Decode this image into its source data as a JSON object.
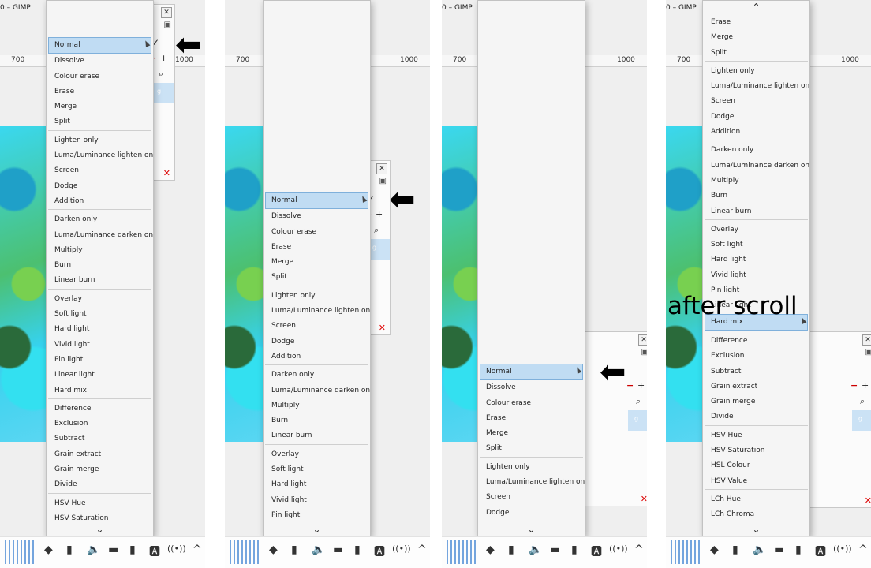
{
  "titles": [
    "0 – GIMP",
    "0 – GIMP",
    "0 – GIMP"
  ],
  "ruler": {
    "left": "700",
    "right": "1000"
  },
  "dock": {
    "close": "✕",
    "mode": "✓",
    "minus": "−",
    "plus": "+",
    "search": "⌕",
    "delete": "✕",
    "brush": "▣"
  },
  "arrow": "⬅",
  "overlay_text": "after scroll",
  "menu_full": [
    "Normal",
    "Dissolve",
    "Colour erase",
    "Erase",
    "Merge",
    "Split",
    "-",
    "Lighten only",
    "Luma/Luminance lighten only",
    "Screen",
    "Dodge",
    "Addition",
    "-",
    "Darken only",
    "Luma/Luminance darken only",
    "Multiply",
    "Burn",
    "Linear burn",
    "-",
    "Overlay",
    "Soft light",
    "Hard light",
    "Vivid light",
    "Pin light",
    "Linear light",
    "Hard mix",
    "-",
    "Difference",
    "Exclusion",
    "Subtract",
    "Grain extract",
    "Grain merge",
    "Divide",
    "-",
    "HSV Hue",
    "HSV Saturation"
  ],
  "menu_mid": [
    "Normal",
    "Dissolve",
    "Colour erase",
    "Erase",
    "Merge",
    "Split",
    "-",
    "Lighten only",
    "Luma/Luminance lighten only",
    "Screen",
    "Dodge",
    "Addition",
    "-",
    "Darken only",
    "Luma/Luminance darken only",
    "Multiply",
    "Burn",
    "Linear burn",
    "-",
    "Overlay",
    "Soft light",
    "Hard light",
    "Vivid light",
    "Pin light"
  ],
  "menu_low": [
    "Normal",
    "Dissolve",
    "Colour erase",
    "Erase",
    "Merge",
    "Split",
    "-",
    "Lighten only",
    "Luma/Luminance lighten only",
    "Screen",
    "Dodge"
  ],
  "menu_scrolled": [
    "Erase",
    "Merge",
    "Split",
    "-",
    "Lighten only",
    "Luma/Luminance lighten only",
    "Screen",
    "Dodge",
    "Addition",
    "-",
    "Darken only",
    "Luma/Luminance darken only",
    "Multiply",
    "Burn",
    "Linear burn",
    "-",
    "Overlay",
    "Soft light",
    "Hard light",
    "Vivid light",
    "Pin light",
    "Linear light",
    "Hard mix",
    "-",
    "Difference",
    "Exclusion",
    "Subtract",
    "Grain extract",
    "Grain merge",
    "Divide",
    "-",
    "HSV Hue",
    "HSV Saturation",
    "HSL Colour",
    "HSV Value",
    "-",
    "LCh Hue",
    "LCh Chroma"
  ],
  "taskbar": {
    "icons": [
      "◆",
      "▮",
      "🔈",
      "▬",
      "▮",
      "🅰",
      "((•))",
      "^"
    ]
  },
  "chevrons": {
    "up": "⌃",
    "down": "⌄"
  }
}
